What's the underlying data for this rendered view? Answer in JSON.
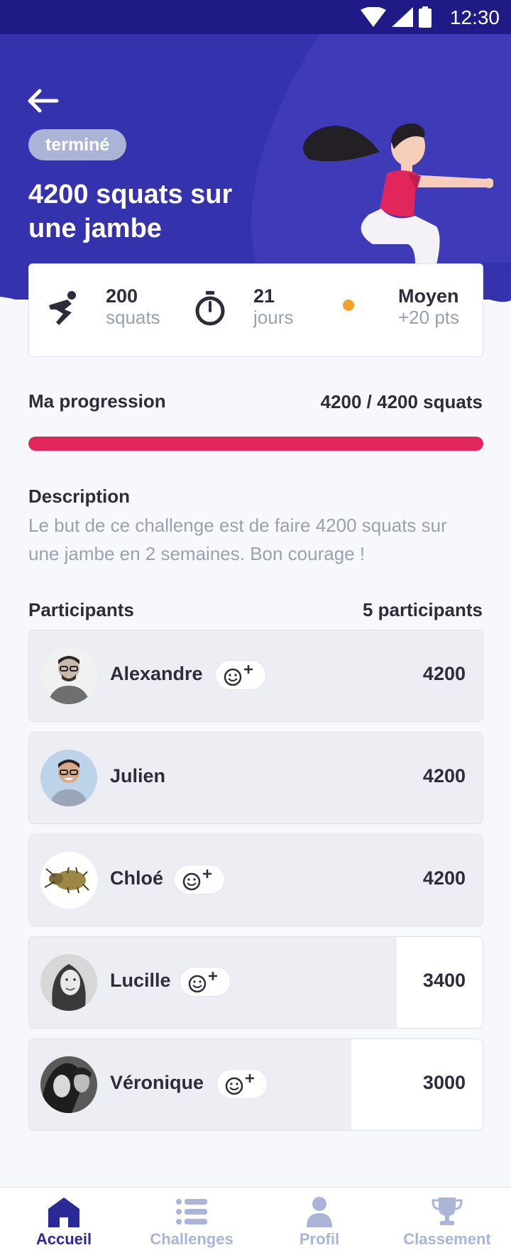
{
  "status_bar": {
    "time": "12:30"
  },
  "challenge": {
    "status": "terminé",
    "title": "4200 squats sur une jambe"
  },
  "stats": [
    {
      "value": "200",
      "unit": "squats",
      "icon": "squat-icon"
    },
    {
      "value": "21",
      "unit": "jours",
      "icon": "stopwatch-icon"
    },
    {
      "value": "Moyen",
      "unit": "+20 pts",
      "icon": "difficulty-dot-icon",
      "dot_color": "#f2a22b"
    }
  ],
  "progress": {
    "label": "Ma progression",
    "value_text": "4200 / 4200 squats",
    "current": 4200,
    "total": 4200,
    "color": "#e0265a"
  },
  "description": {
    "label": "Description",
    "text": "Le but de ce challenge est de faire 4200 squats sur une jambe en 2 semaines. Bon courage !"
  },
  "participants": {
    "label": "Participants",
    "count_text": "5 participants",
    "items": [
      {
        "name": "Alexandre",
        "score": "4200",
        "progress": 1.0,
        "has_reaction": true
      },
      {
        "name": "Julien",
        "score": "4200",
        "progress": 1.0,
        "has_reaction": false
      },
      {
        "name": "Chloé",
        "score": "4200",
        "progress": 1.0,
        "has_reaction": true
      },
      {
        "name": "Lucille",
        "score": "3400",
        "progress": 0.81,
        "has_reaction": true
      },
      {
        "name": "Véronique",
        "score": "3000",
        "progress": 0.71,
        "has_reaction": true
      }
    ]
  },
  "bottom_nav": {
    "items": [
      {
        "label": "Accueil",
        "icon": "home-icon",
        "active": true
      },
      {
        "label": "Challenges",
        "icon": "list-icon",
        "active": false
      },
      {
        "label": "Profil",
        "icon": "profile-icon",
        "active": false
      },
      {
        "label": "Classement",
        "icon": "trophy-icon",
        "active": false
      }
    ]
  },
  "colors": {
    "header": "#3532ad",
    "status_bar": "#1f1a86",
    "accent": "#e0265a",
    "nav_active": "#2a2a97",
    "nav_inactive": "#a9b4d7"
  }
}
